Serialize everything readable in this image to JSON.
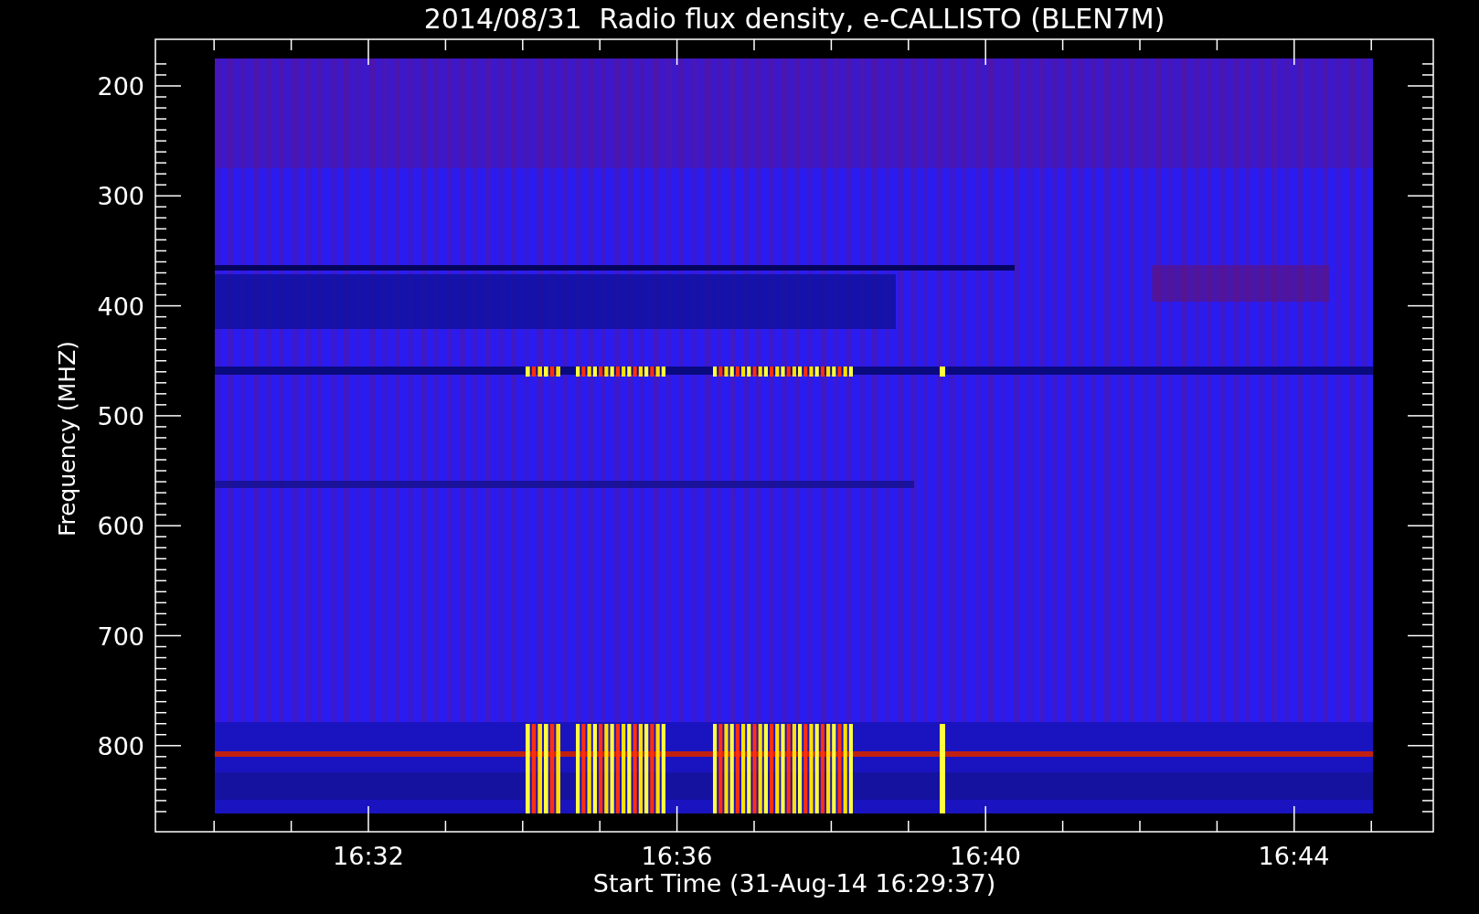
{
  "title": "2014/08/31  Radio flux density, e-CALLISTO (BLEN7M)",
  "y_axis": {
    "label": "Frequency (MHZ)",
    "ticks": [
      "200",
      "300",
      "400",
      "500",
      "600",
      "700",
      "800"
    ]
  },
  "x_axis": {
    "label": "Start Time (31-Aug-14 16:29:37)",
    "ticks": [
      "16:32",
      "16:36",
      "16:40",
      "16:44"
    ]
  }
}
